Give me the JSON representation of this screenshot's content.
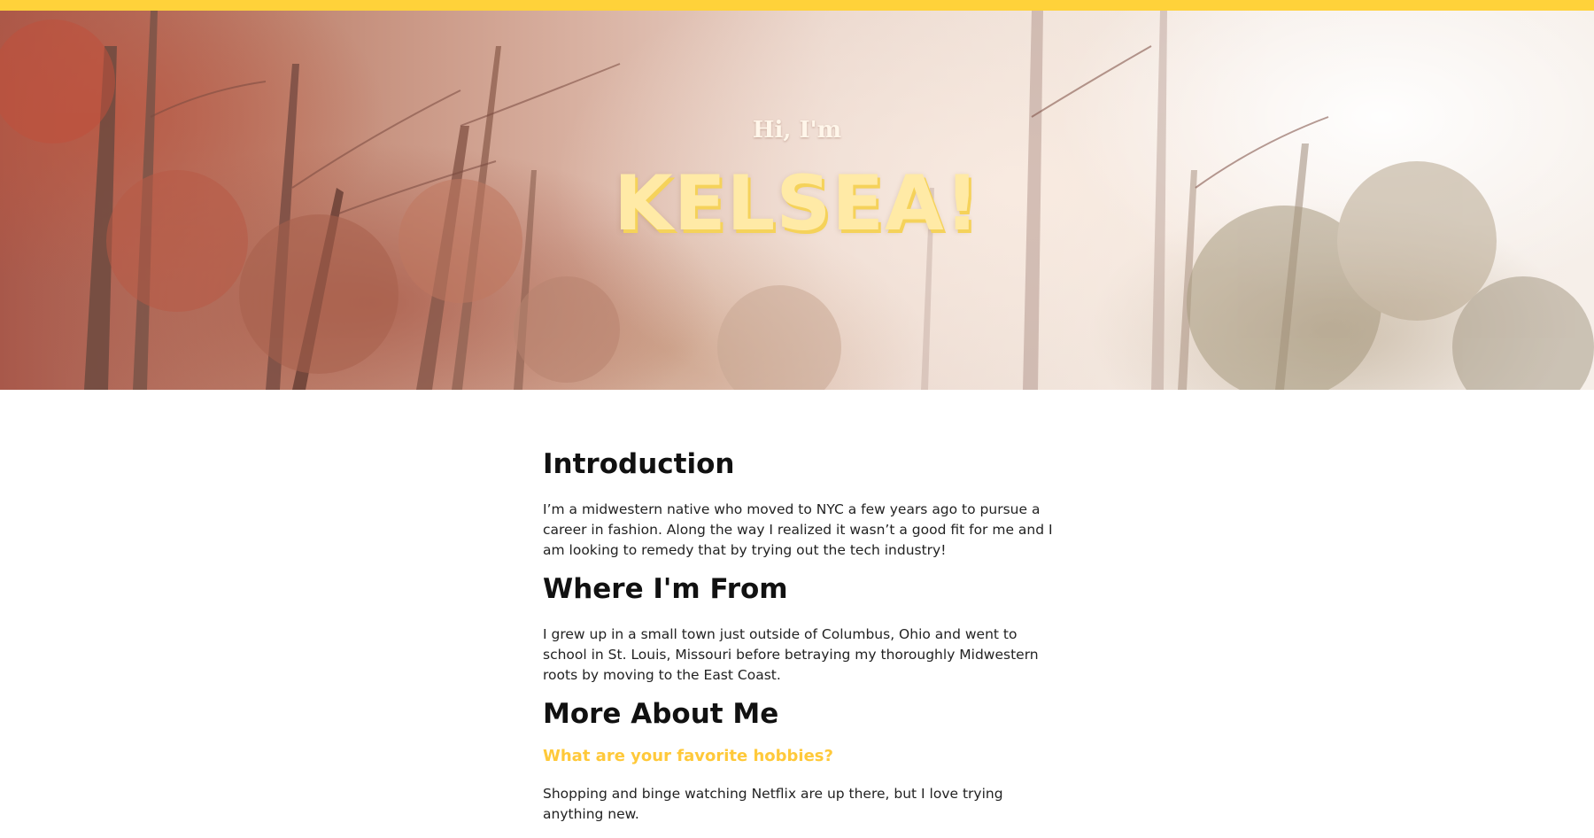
{
  "colors": {
    "accent_bar": "#ffd23a",
    "hero_name": "#ffeaa6",
    "subheading": "#ffc93a"
  },
  "hero": {
    "greeting": "Hi, I'm",
    "name": "KELSEA!"
  },
  "sections": [
    {
      "heading": "Introduction",
      "body": "I’m a midwestern native who moved to NYC a few years ago to pursue a career in fashion. Along the way I realized it wasn’t a good fit for me and I am looking to remedy that by trying out the tech industry!"
    },
    {
      "heading": "Where I'm From",
      "body": "I grew up in a small town just outside of Columbus, Ohio and went to school in St. Louis, Missouri before betraying my thoroughly Midwestern roots by moving to the East Coast."
    },
    {
      "heading": "More About Me",
      "question": "What are your favorite hobbies?",
      "body": "Shopping and binge watching Netflix are up there, but I love trying anything new."
    }
  ]
}
